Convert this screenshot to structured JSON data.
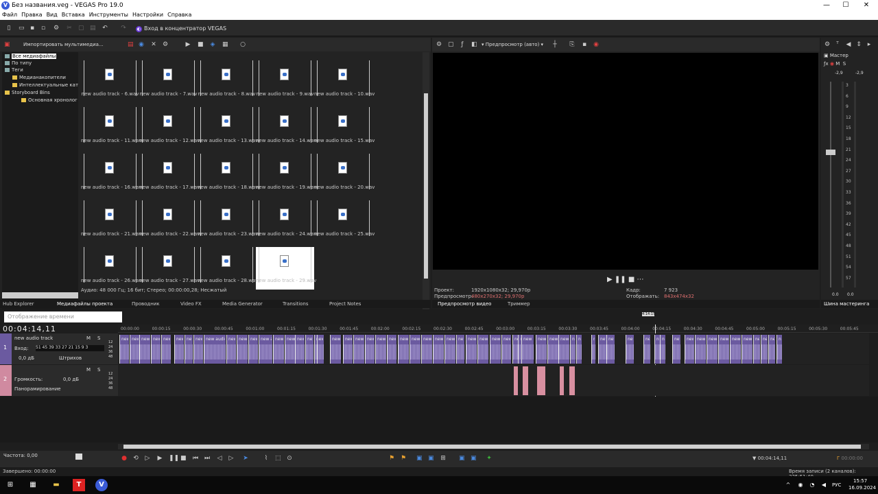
{
  "window": {
    "title": "Без названия.veg - VEGAS Pro 19.0",
    "logo": "V"
  },
  "menu": [
    "Файл",
    "Правка",
    "Вид",
    "Вставка",
    "Инструменты",
    "Настройки",
    "Справка"
  ],
  "toolbar": {
    "hub_label": "Вход в концентратор VEGAS"
  },
  "explorer": {
    "import_label": "Импортировать мультимедиа...",
    "tree": [
      {
        "label": "Все медиафайлы",
        "selected": true
      },
      {
        "label": "По типу"
      },
      {
        "label": "Теги"
      },
      {
        "label": "Медианакопители"
      },
      {
        "label": "Интеллектуальные кат"
      },
      {
        "label": "Storyboard Bins"
      },
      {
        "label": "Основная хронолог"
      }
    ],
    "files": [
      "new audio track - 6.wav",
      "new audio track - 7.wav",
      "new audio track - 8.wav",
      "new audio track - 9.wav",
      "new audio track - 10.wav",
      "new audio track - 11.wav",
      "new audio track - 12.wav",
      "new audio track - 13.wav",
      "new audio track - 14.wav",
      "new audio track - 15.wav",
      "new audio track - 16.wav",
      "new audio track - 17.wav",
      "new audio track - 18.wav",
      "new audio track - 19.wav",
      "new audio track - 20.wav",
      "new audio track - 21.wav",
      "new audio track - 22.wav",
      "new audio track - 23.wav",
      "new audio track - 24.wav",
      "new audio track - 25.wav",
      "new audio track - 26.wav",
      "new audio track - 27.wav",
      "new audio track - 28.wav",
      "new audio track - 29.wav"
    ],
    "status": "Аудио: 48 000 Гц; 16 бит; Стерео; 00:00:00,28; Несжатый"
  },
  "tabs": [
    "Hub Explorer",
    "Медиафайлы проекта",
    "Проводник",
    "Video FX",
    "Media Generator",
    "Transitions",
    "Project Notes"
  ],
  "preview": {
    "mode_label": "Предпросмотр (авто)",
    "tab_label": "Предпросмотр видео",
    "tab2_label": "Триммер",
    "project_label": "Проект:",
    "project_value": "1920x1080x32; 29,970p",
    "preview_label": "Предпросмотр:",
    "preview_value": "480x270x32; 29,970p",
    "frame_label": "Кадр:",
    "frame_value": "7 923",
    "display_label": "Отображать:",
    "display_value": "843x474x32"
  },
  "master": {
    "label": "Мастер",
    "m": "M",
    "s": "S",
    "peak_l": "-2,9",
    "peak_r": "-2,9",
    "ticks": [
      "3",
      "6",
      "9",
      "12",
      "15",
      "18",
      "21",
      "24",
      "27",
      "30",
      "33",
      "36",
      "39",
      "42",
      "45",
      "48",
      "51",
      "54",
      "57"
    ],
    "bottom_l": "0.0",
    "bottom_r": "0.0",
    "tab_label": "Шина мастеринга"
  },
  "timeline": {
    "time_placeholder": "Отображение времени",
    "timecode": "00:04:14,11",
    "cursor_time": "4:14:15",
    "ruler": [
      "00:00:00",
      "00:00:15",
      "00:00:30",
      "00:00:45",
      "00:01:00",
      "00:01:15",
      "00:01:30",
      "00:01:45",
      "00:02:00",
      "00:02:15",
      "00:02:30",
      "00:02:45",
      "00:03:00",
      "00:03:15",
      "00:03:30",
      "00:03:45",
      "00:04:00",
      "00:04:15",
      "00:04:30",
      "00:04:45",
      "00:05:00",
      "00:05:15",
      "00:05:30",
      "00:05:45"
    ],
    "track1": {
      "number": "1",
      "name": "new audio track",
      "m": "M",
      "s": "S",
      "input_label": "Вход:",
      "level_ticks": "51 45 39 33 27 21 15 9 3",
      "vol": "0,0 дБ",
      "mode": "Штрихов",
      "scale": "12 24 36 48"
    },
    "track2": {
      "number": "2",
      "vol_label": "Громкость:",
      "vol": "0,0 дБ",
      "pan": "Панорамирование",
      "mode": "вирование",
      "m": "M",
      "s": "S",
      "scale": "12 24 36 48"
    },
    "clip_label": "new audio track"
  },
  "transport": {
    "rate_label": "Частота: 0,00",
    "time_left": "00:04:14,11",
    "time_right": "00:00:00"
  },
  "status": {
    "completed": "Завершено: 00:00:00",
    "record_time": "Время записи (2 каналов): 325:51:40"
  },
  "taskbar": {
    "lang": "РУС",
    "time": "15:57",
    "date": "16.09.2024"
  }
}
